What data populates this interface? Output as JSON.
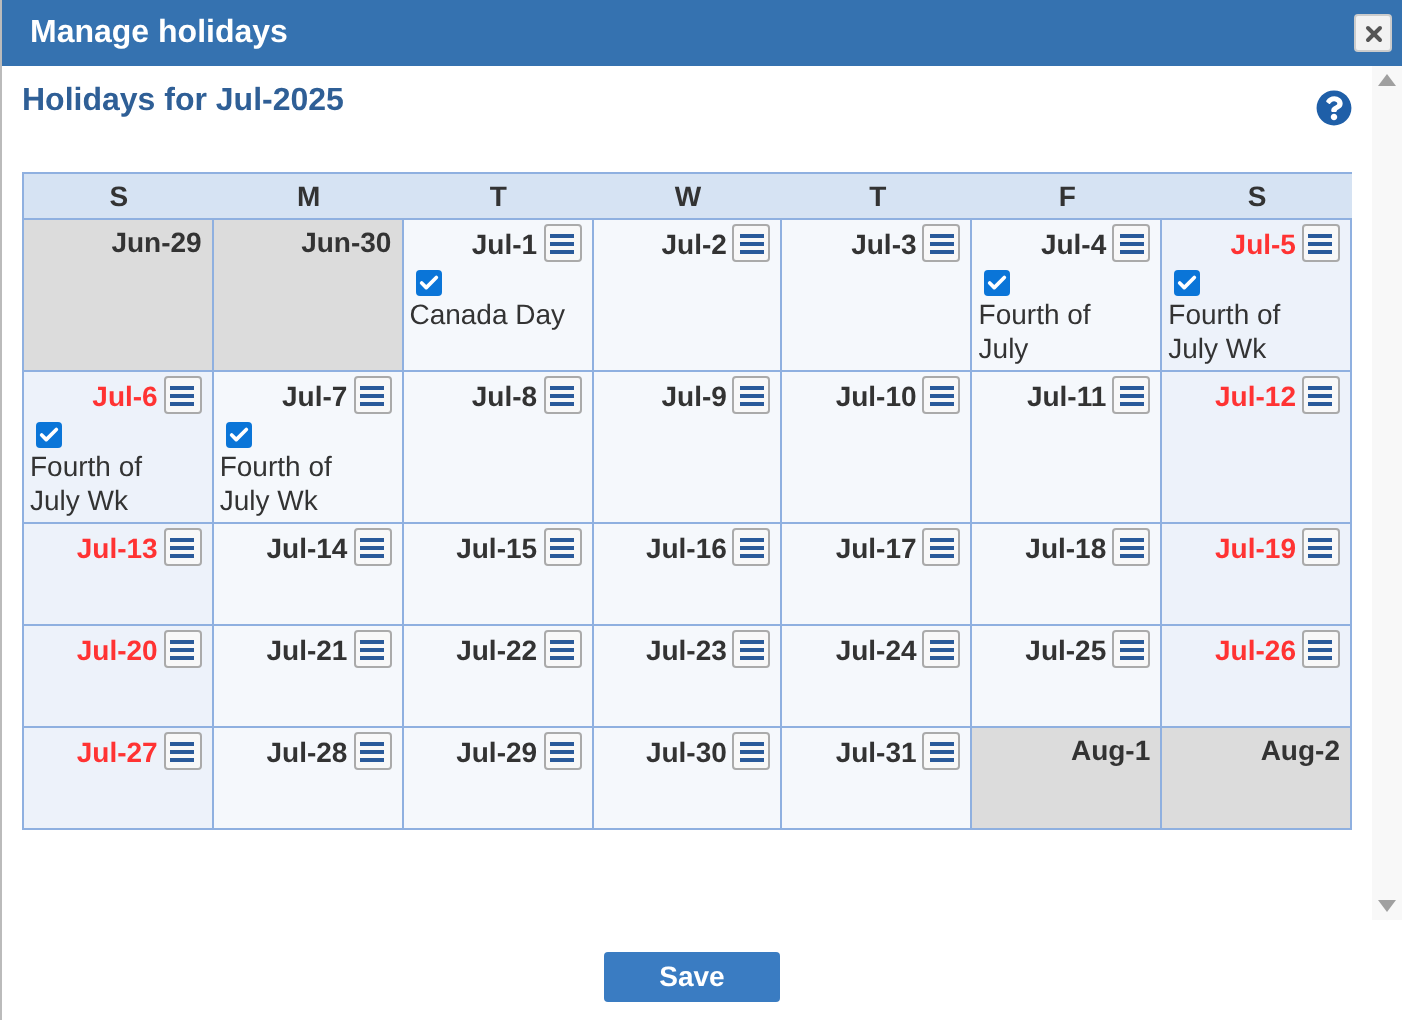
{
  "window": {
    "title": "Manage holidays"
  },
  "heading": "Holidays for Jul-2025",
  "weekdays": [
    "S",
    "M",
    "T",
    "W",
    "T",
    "F",
    "S"
  ],
  "weeks": [
    [
      {
        "date": "Jun-29",
        "kind": "outside"
      },
      {
        "date": "Jun-30",
        "kind": "outside"
      },
      {
        "date": "Jul-1",
        "kind": "weekday",
        "holiday": {
          "label": "Canada Day",
          "checked": true
        }
      },
      {
        "date": "Jul-2",
        "kind": "weekday"
      },
      {
        "date": "Jul-3",
        "kind": "weekday"
      },
      {
        "date": "Jul-4",
        "kind": "weekday",
        "holiday": {
          "label": "Fourth of July",
          "checked": true
        }
      },
      {
        "date": "Jul-5",
        "kind": "weekend",
        "holiday": {
          "label": "Fourth of July Wk",
          "checked": true
        }
      }
    ],
    [
      {
        "date": "Jul-6",
        "kind": "weekend",
        "holiday": {
          "label": "Fourth of July Wk",
          "checked": true
        }
      },
      {
        "date": "Jul-7",
        "kind": "weekday",
        "holiday": {
          "label": "Fourth of July Wk",
          "checked": true
        }
      },
      {
        "date": "Jul-8",
        "kind": "weekday"
      },
      {
        "date": "Jul-9",
        "kind": "weekday"
      },
      {
        "date": "Jul-10",
        "kind": "weekday"
      },
      {
        "date": "Jul-11",
        "kind": "weekday"
      },
      {
        "date": "Jul-12",
        "kind": "weekend"
      }
    ],
    [
      {
        "date": "Jul-13",
        "kind": "weekend"
      },
      {
        "date": "Jul-14",
        "kind": "weekday"
      },
      {
        "date": "Jul-15",
        "kind": "weekday"
      },
      {
        "date": "Jul-16",
        "kind": "weekday"
      },
      {
        "date": "Jul-17",
        "kind": "weekday"
      },
      {
        "date": "Jul-18",
        "kind": "weekday"
      },
      {
        "date": "Jul-19",
        "kind": "weekend"
      }
    ],
    [
      {
        "date": "Jul-20",
        "kind": "weekend"
      },
      {
        "date": "Jul-21",
        "kind": "weekday"
      },
      {
        "date": "Jul-22",
        "kind": "weekday"
      },
      {
        "date": "Jul-23",
        "kind": "weekday"
      },
      {
        "date": "Jul-24",
        "kind": "weekday"
      },
      {
        "date": "Jul-25",
        "kind": "weekday"
      },
      {
        "date": "Jul-26",
        "kind": "weekend"
      }
    ],
    [
      {
        "date": "Jul-27",
        "kind": "weekend"
      },
      {
        "date": "Jul-28",
        "kind": "weekday"
      },
      {
        "date": "Jul-29",
        "kind": "weekday"
      },
      {
        "date": "Jul-30",
        "kind": "weekday"
      },
      {
        "date": "Jul-31",
        "kind": "weekday"
      },
      {
        "date": "Aug-1",
        "kind": "outside"
      },
      {
        "date": "Aug-2",
        "kind": "outside"
      }
    ]
  ],
  "save_button": "Save"
}
